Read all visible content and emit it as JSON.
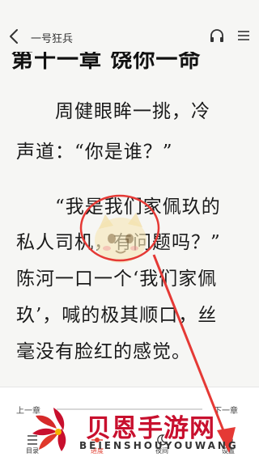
{
  "header": {
    "book_title": "一号狂兵",
    "back_icon": "chevron-left-icon",
    "headphone_icon": "headphone-icon",
    "menu_icon": "menu-icon"
  },
  "content": {
    "chapter_title": "第十一章 饶你一命",
    "lines": [
      "　　周健眼眸一挑，冷",
      "声道：“你是谁？”",
      "　　“我是我们家佩玖的",
      "私人司机，有问题吗？”",
      "陈河一口一个‘我们家佩",
      "玖’，喊的极其顺口，丝",
      "毫没有脸红的感觉。"
    ]
  },
  "controls": {
    "prev_chapter": "上一章",
    "next_chapter": "下一章",
    "nav": [
      {
        "label": "目录",
        "icon": "catalog-icon"
      },
      {
        "label": "进度",
        "icon": "progress-icon"
      },
      {
        "label": "夜间",
        "icon": "night-mode-icon"
      },
      {
        "label": "设置",
        "icon": "settings-icon"
      }
    ],
    "active_color": "#e0392b"
  },
  "watermark": {
    "text": "贝恩手游网",
    "subtext": "BEIENSHOUYOUWANG",
    "color": "#c8102e"
  },
  "annotation_color": "#e53935"
}
